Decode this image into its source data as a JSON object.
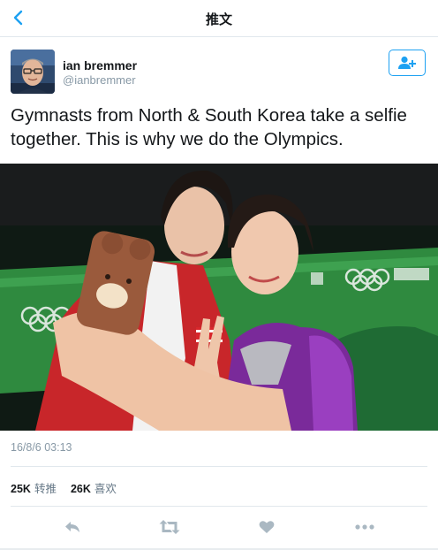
{
  "nav": {
    "back_icon": "chevron-left-icon",
    "title": "推文"
  },
  "author": {
    "name": "ian bremmer",
    "handle": "@ianbremmer",
    "follow_icon": "add-user-icon"
  },
  "tweet": {
    "text": "Gymnasts from North & South Korea take a selfie together. This is why we do the Olympics.",
    "timestamp": "16/8/6 03:13"
  },
  "stats": {
    "retweets_count": "25K",
    "retweets_label": "转推",
    "likes_count": "26K",
    "likes_label": "喜欢"
  },
  "actions": [
    "reply-icon",
    "retweet-icon",
    "heart-icon",
    "more-icon"
  ],
  "colors": {
    "accent": "#1da1f2",
    "muted": "#8899a6",
    "action_gray": "#aab8c2",
    "divider": "#e1e8ed"
  }
}
